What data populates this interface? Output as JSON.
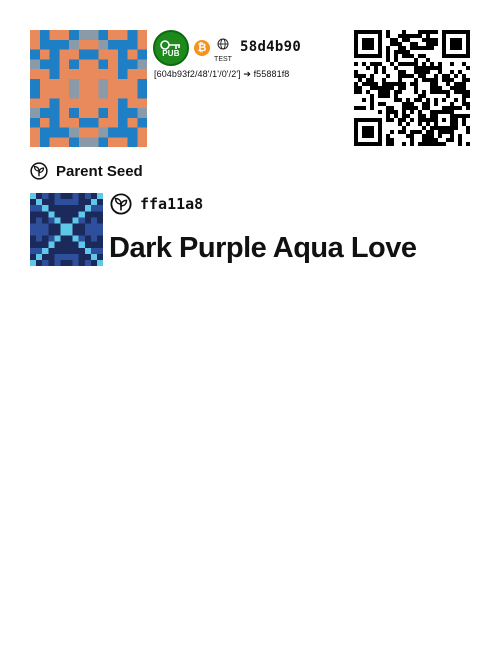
{
  "key": {
    "pub_badge_label": "PUB",
    "bitcoin_icon": "bitcoin-icon",
    "network_label": "TEST",
    "fingerprint": "58d4b90",
    "derivation": "[604b93f2/48'/1'/0'/2'] ➔ f55881f8",
    "identicon_colors": {
      "background": "#e88a5c",
      "primary": "#1f7fc4",
      "secondary": "#8a9aa8"
    }
  },
  "parent_seed": {
    "header_label": "Parent Seed",
    "fingerprint": "ffa11a8",
    "name": "Dark Purple Aqua Love",
    "identicon_colors": {
      "background": "#1b2a5a",
      "primary": "#2d4f9c",
      "accent": "#5ec8e8"
    }
  },
  "colors": {
    "pub_badge": "#1e8a1e",
    "bitcoin": "#f7931a"
  }
}
